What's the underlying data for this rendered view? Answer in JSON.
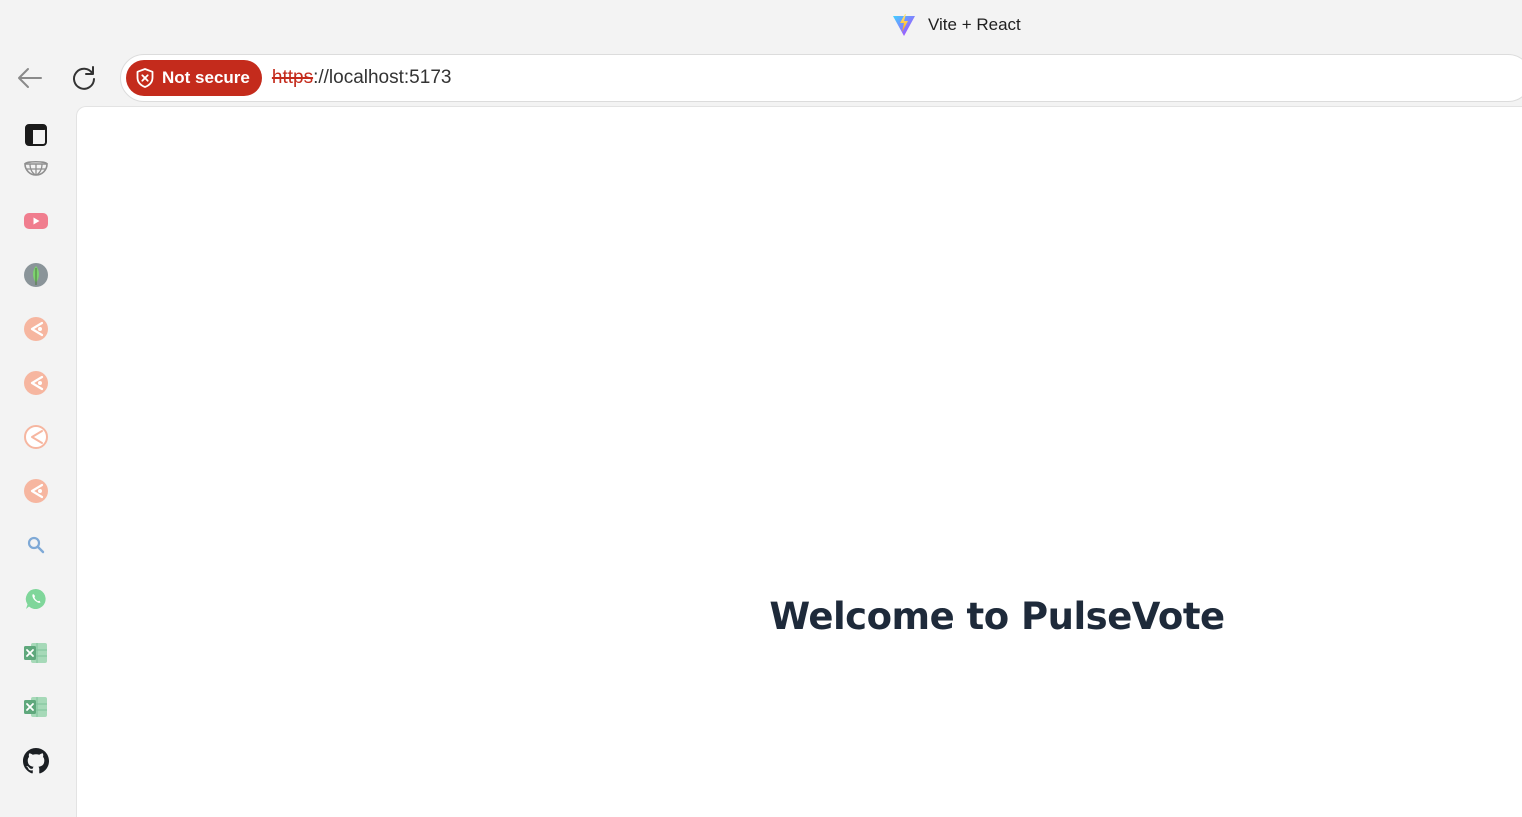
{
  "tab": {
    "title": "Vite + React",
    "favicon": "vite-logo-icon"
  },
  "toolbar": {
    "back_icon": "arrow-left-icon",
    "reload_icon": "refresh-icon"
  },
  "addressbar": {
    "security_label": "Not secure",
    "security_icon": "shield-warning-icon",
    "security_color": "#c42b1c",
    "url_scheme": "https",
    "url_rest": "://localhost:5173"
  },
  "sidebar": {
    "items": [
      {
        "icon": "sidebar-panel-icon"
      },
      {
        "icon": "globe-icon"
      },
      {
        "icon": "youtube-icon"
      },
      {
        "icon": "mongodb-leaf-icon"
      },
      {
        "icon": "app-icon"
      },
      {
        "icon": "app-icon"
      },
      {
        "icon": "app-outline-icon"
      },
      {
        "icon": "app-icon"
      },
      {
        "icon": "search-icon"
      },
      {
        "icon": "whatsapp-icon"
      },
      {
        "icon": "excel-icon"
      },
      {
        "icon": "excel-icon"
      },
      {
        "icon": "github-icon"
      }
    ]
  },
  "page": {
    "heading": "Welcome to PulseVote",
    "heading_color": "#1e2a3a"
  }
}
